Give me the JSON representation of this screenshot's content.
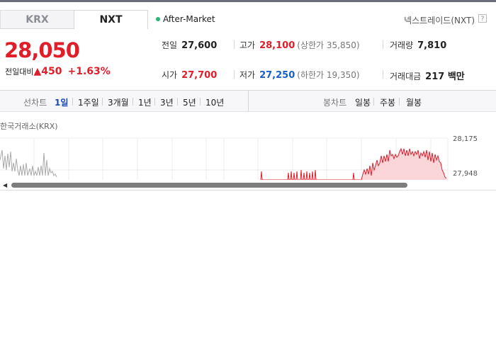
{
  "tabs": [
    {
      "label": "KRX",
      "active": false
    },
    {
      "label": "NXT",
      "active": true
    }
  ],
  "status": {
    "label": "After-Market",
    "dot_color": "#2bb673"
  },
  "venue": {
    "label": "넥스트레이드(NXT)",
    "help": "?"
  },
  "quote": {
    "price": "28,050",
    "change_label": "전일대비",
    "change_value": "450",
    "change_symbol": "▲",
    "change_pct": "+1.63%"
  },
  "stats": {
    "prev_close": {
      "label": "전일",
      "value": "27,600"
    },
    "high": {
      "label": "고가",
      "value": "28,100",
      "sub": "(상한가 35,850)"
    },
    "volume": {
      "label": "거래량",
      "value": "7,810"
    },
    "open": {
      "label": "시가",
      "value": "27,700"
    },
    "low": {
      "label": "저가",
      "value": "27,250",
      "sub": "(하한가 19,350)"
    },
    "amount": {
      "label": "거래대금",
      "value": "217 백만"
    }
  },
  "toolbar": {
    "line_label": "선차트",
    "periods": [
      "1일",
      "1주일",
      "3개월",
      "1년",
      "3년",
      "5년",
      "10년"
    ],
    "selected_period": "1일",
    "candle_label": "봉차트",
    "candles": [
      "일봉",
      "주봉",
      "월봉"
    ]
  },
  "chart": {
    "label": "한국거래소(KRX)",
    "y_ticks": [
      "28,175",
      "27,948"
    ],
    "line_color": "#e11d2a",
    "fill_color": "#fbd6d8",
    "grey_color": "#aaaaaa"
  }
}
